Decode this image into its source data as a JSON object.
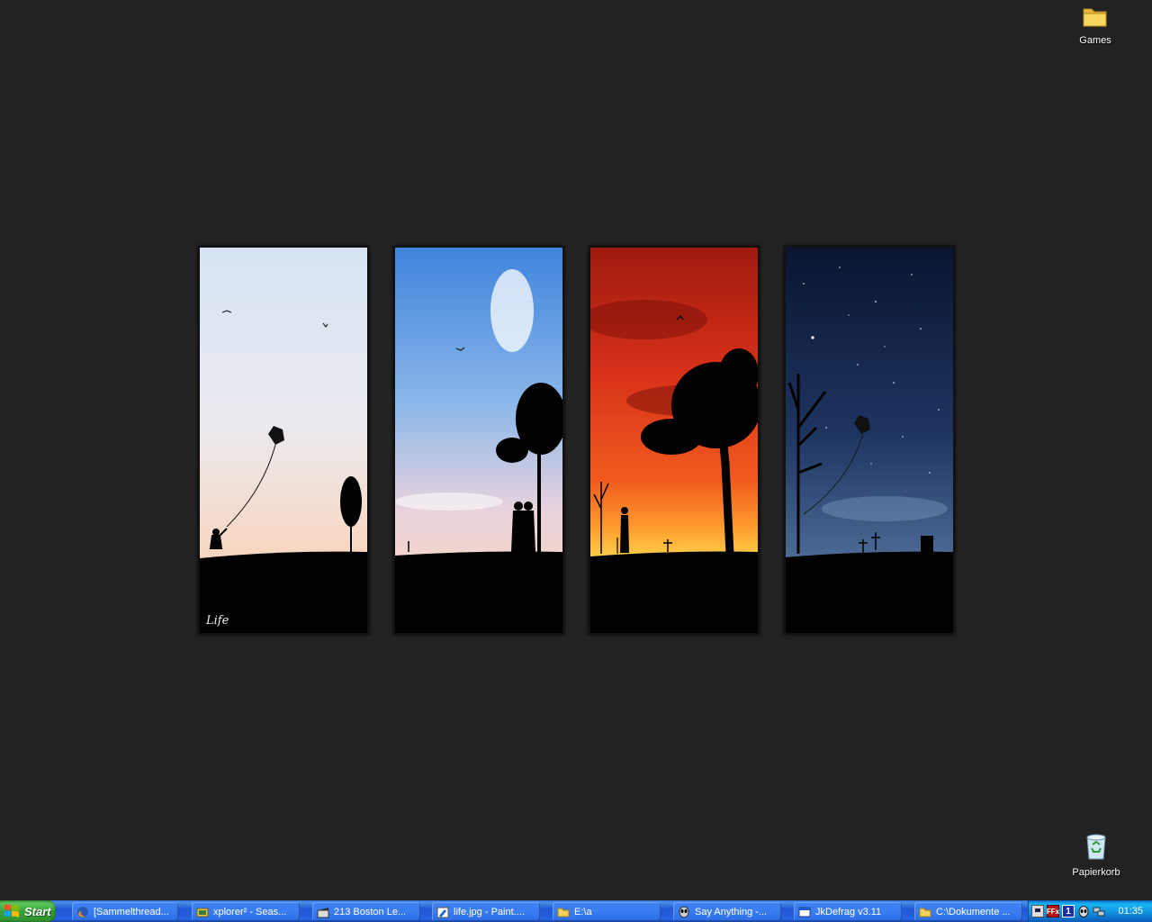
{
  "desktop": {
    "icons": [
      {
        "label": "Games",
        "icon": "folder-icon"
      },
      {
        "label": "Papierkorb",
        "icon": "recycle-bin-icon"
      }
    ],
    "wallpaper": {
      "signature": "Life",
      "panels": [
        {
          "scene": "day-kite",
          "sky_top": "#d9e6f3",
          "sky_bottom": "#f6dcc8"
        },
        {
          "scene": "blue-sky-couple",
          "sky_top": "#4a8cdc",
          "sky_bottom": "#f2d4d6"
        },
        {
          "scene": "red-sunset-tree",
          "sky_top": "#a81c0e",
          "sky_bottom": "#ffb63a"
        },
        {
          "scene": "starry-night",
          "sky_top": "#0b1730",
          "sky_bottom": "#4a6690"
        }
      ]
    }
  },
  "taskbar": {
    "start_label": "Start",
    "tasks": [
      {
        "label": "[Sammelthread...",
        "icon": "firefox-icon"
      },
      {
        "label": "xplorer² - Seas...",
        "icon": "xplorer-icon"
      },
      {
        "label": "213 Boston Le...",
        "icon": "clapper-icon"
      },
      {
        "label": "life.jpg - Paint....",
        "icon": "paint-icon"
      },
      {
        "label": "E:\\a",
        "icon": "folder-icon"
      },
      {
        "label": "Say Anything -...",
        "icon": "alien-icon"
      },
      {
        "label": "JkDefrag v3.11",
        "icon": "window-icon"
      },
      {
        "label": "C:\\Dokumente ...",
        "icon": "folder-icon"
      }
    ],
    "tray": {
      "icons": [
        "monitor-icon",
        "ffx-icon",
        "one-icon",
        "alien-icon",
        "network-icon"
      ],
      "ffx_text": "FFx",
      "one_text": "1",
      "clock": "01:35"
    }
  }
}
